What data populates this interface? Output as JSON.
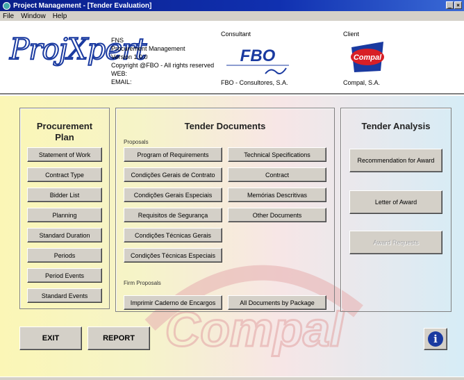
{
  "window": {
    "title": "Project Management - [Tender Evaluation]",
    "buttons": [
      "_",
      "×"
    ]
  },
  "menu": {
    "items": [
      "File",
      "Window",
      "Help"
    ]
  },
  "header": {
    "logo_text": "ProjXpert",
    "info_lines": [
      "FNS",
      "Procurement Management",
      "Version 1.0.0",
      "Copyright @FBO - All rights reserved",
      "WEB:",
      "EMAIL:"
    ],
    "consultant_label": "Consultant",
    "consultant_logo_text": "FBO",
    "consultant_name": "FBO - Consultores, S.A.",
    "client_label": "Client",
    "client_logo_text": "Compal",
    "client_name": "Compal, S.A."
  },
  "procurement_plan": {
    "title": "Procurement Plan",
    "buttons": [
      "Statement of Work",
      "Contract Type",
      "Bidder List",
      "Planning",
      "Standard Duration",
      "Periods",
      "Period Events",
      "Standard Events"
    ]
  },
  "tender_documents": {
    "title": "Tender Documents",
    "proposals_label": "Proposals",
    "left_buttons": [
      "Program of Requirements",
      "Condições Gerais de Contrato",
      "Condições Gerais Especiais",
      "Requisitos de Segurança",
      "Condições Técnicas Gerais",
      "Condições Técnicas Especiais"
    ],
    "right_buttons": [
      "Technical Specifications",
      "Contract",
      "Memórias Descritivas",
      "Other Documents"
    ],
    "firm_proposals_label": "Firm Proposals",
    "print_button": "Imprimir Caderno de Encargos",
    "all_docs_button": "All Documents by Package"
  },
  "tender_analysis": {
    "title": "Tender Analysis",
    "buttons": [
      "Recommendation for Award",
      "Letter of Award"
    ],
    "disabled_button": "Award Requests"
  },
  "footer": {
    "exit": "EXIT",
    "report": "REPORT",
    "info_icon": "i"
  },
  "colors": {
    "title_bar": "#0a1f8a",
    "button_face": "#d4d0c8",
    "logo_blue": "#1a3aa0",
    "info_icon": "#1a3aa0"
  }
}
